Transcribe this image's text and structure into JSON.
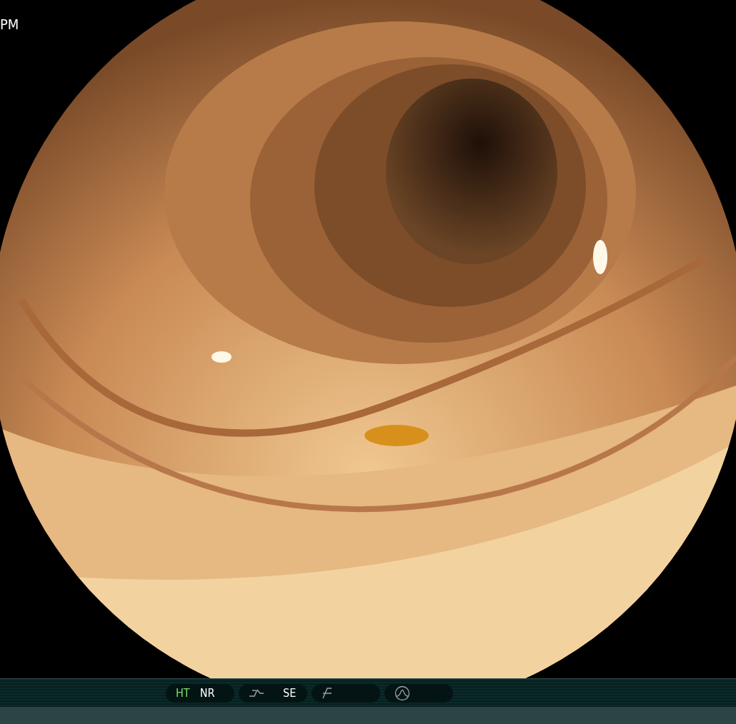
{
  "overlay": {
    "time_fragment": "PM"
  },
  "status_bar": {
    "groups": [
      {
        "kind": "text",
        "items": [
          {
            "label": "HT",
            "selected": true
          },
          {
            "label": "NR",
            "selected": false
          }
        ]
      },
      {
        "kind": "curve",
        "items": [
          {
            "label": "SE",
            "selected": false
          }
        ]
      },
      {
        "kind": "slash"
      },
      {
        "kind": "peak"
      }
    ]
  }
}
